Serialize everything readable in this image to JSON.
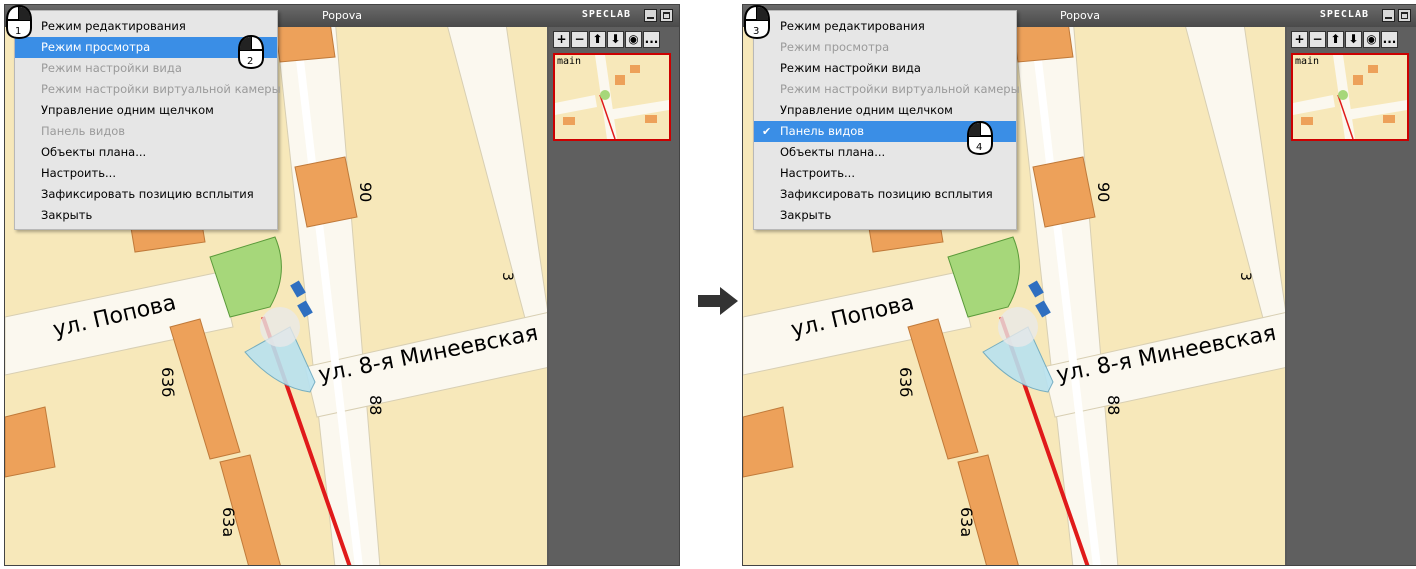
{
  "panels": [
    {
      "window_title": "Popova",
      "brand": "SPECLAB",
      "toolbar": [
        "+",
        "−",
        "⬆",
        "⬇",
        "◉",
        "..."
      ],
      "minimap_label": "main",
      "menu": [
        {
          "label": "Режим редактирования",
          "state": "normal"
        },
        {
          "label": "Режим просмотра",
          "state": "highlighted"
        },
        {
          "label": "Режим настройки вида",
          "state": "disabled"
        },
        {
          "label": "Режим настройки виртуальной камеры",
          "state": "disabled"
        },
        {
          "label": "Управление одним щелчком",
          "state": "normal"
        },
        {
          "label": "Панель видов",
          "state": "disabled"
        },
        {
          "label": "Объекты плана...",
          "state": "normal"
        },
        {
          "label": "Настроить...",
          "state": "normal"
        },
        {
          "label": "Зафиксировать позицию всплытия",
          "state": "normal"
        },
        {
          "label": "Закрыть",
          "state": "normal"
        }
      ],
      "step_a": "1",
      "step_b": "2"
    },
    {
      "window_title": "Popova",
      "brand": "SPECLAB",
      "toolbar": [
        "+",
        "−",
        "⬆",
        "⬇",
        "◉",
        "..."
      ],
      "minimap_label": "main",
      "menu": [
        {
          "label": "Режим редактирования",
          "state": "normal"
        },
        {
          "label": "Режим просмотра",
          "state": "disabled"
        },
        {
          "label": "Режим настройки вида",
          "state": "normal"
        },
        {
          "label": "Режим настройки виртуальной камеры",
          "state": "disabled"
        },
        {
          "label": "Управление одним щелчком",
          "state": "normal"
        },
        {
          "label": "Панель видов",
          "state": "highlighted",
          "checked": "✔"
        },
        {
          "label": "Объекты плана...",
          "state": "normal"
        },
        {
          "label": "Настроить...",
          "state": "normal"
        },
        {
          "label": "Зафиксировать позицию всплытия",
          "state": "normal"
        },
        {
          "label": "Закрыть",
          "state": "normal"
        }
      ],
      "step_a": "3",
      "step_b": "4"
    }
  ],
  "map_labels": {
    "street_popova": "ул. Попова",
    "street_mineevskaya": "ул. 8-я Минеевская",
    "house_90": "90",
    "house_3": "3",
    "house_63b": "63б",
    "house_88": "88",
    "house_63a": "63а"
  },
  "colors": {
    "map_bg": "#f7e8ba",
    "building": "#eda15a",
    "road": "#fbf8ef",
    "rail": "#e01a1a",
    "highlight": "#3a8ee6",
    "frame_red": "#cc0000"
  }
}
